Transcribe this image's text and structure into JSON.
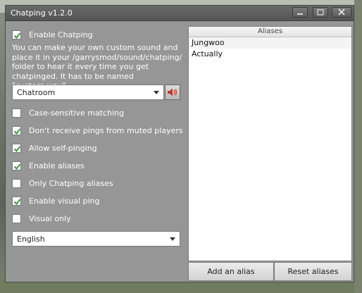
{
  "window": {
    "title": "Chatping v1.2.0"
  },
  "settings": {
    "enable_chatping": {
      "label": "Enable Chatping",
      "checked": true
    },
    "description": "You can make your own custom sound and place it in your /garrysmod/sound/chatping/ folder to hear it every time you get chatpinged. It has to be named \"custom.wav\".",
    "sound": {
      "value": "Chatroom"
    },
    "options": [
      {
        "label": "Case-sensitive matching",
        "checked": false
      },
      {
        "label": "Don't receive pings from muted players",
        "checked": true
      },
      {
        "label": "Allow self-pinging",
        "checked": true
      },
      {
        "label": "Enable aliases",
        "checked": true
      },
      {
        "label": "Only Chatping aliases",
        "checked": false
      },
      {
        "label": "Enable visual ping",
        "checked": true
      },
      {
        "label": "Visual only",
        "checked": false
      }
    ],
    "language": {
      "value": "English"
    }
  },
  "aliases": {
    "header": "Aliases",
    "items": [
      "Jungwoo",
      "Actually"
    ],
    "add_label": "Add an alias",
    "reset_label": "Reset aliases"
  },
  "colors": {
    "window_bg": "#969696",
    "titlebar": "#5c5c5c",
    "check": "#3c9a3c"
  }
}
